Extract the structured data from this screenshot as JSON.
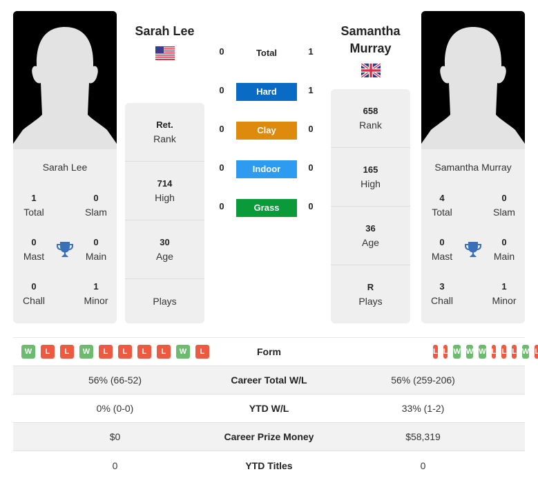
{
  "player1": {
    "name": "Sarah Lee",
    "country_flag": "us-flag-icon",
    "titles": {
      "total": {
        "value": "1",
        "label": "Total"
      },
      "slam": {
        "value": "0",
        "label": "Slam"
      },
      "mast": {
        "value": "0",
        "label": "Mast"
      },
      "main": {
        "value": "0",
        "label": "Main"
      },
      "chall": {
        "value": "0",
        "label": "Chall"
      },
      "minor": {
        "value": "1",
        "label": "Minor"
      }
    },
    "stats": {
      "rank": {
        "value": "Ret.",
        "label": "Rank"
      },
      "high": {
        "value": "714",
        "label": "High"
      },
      "age": {
        "value": "30",
        "label": "Age"
      },
      "plays": {
        "value": "",
        "label": "Plays"
      }
    },
    "form": [
      "W",
      "L",
      "L",
      "W",
      "L",
      "L",
      "L",
      "L",
      "W",
      "L"
    ]
  },
  "player2": {
    "name": "Samantha Murray",
    "country_flag": "uk-flag-icon",
    "titles": {
      "total": {
        "value": "4",
        "label": "Total"
      },
      "slam": {
        "value": "0",
        "label": "Slam"
      },
      "mast": {
        "value": "0",
        "label": "Mast"
      },
      "main": {
        "value": "0",
        "label": "Main"
      },
      "chall": {
        "value": "3",
        "label": "Chall"
      },
      "minor": {
        "value": "1",
        "label": "Minor"
      }
    },
    "stats": {
      "rank": {
        "value": "658",
        "label": "Rank"
      },
      "high": {
        "value": "165",
        "label": "High"
      },
      "age": {
        "value": "36",
        "label": "Age"
      },
      "plays": {
        "value": "R",
        "label": "Plays"
      }
    },
    "form": [
      "L",
      "L",
      "W",
      "W",
      "W",
      "L",
      "L",
      "L",
      "W",
      "L"
    ]
  },
  "h2h": {
    "total": {
      "label": "Total",
      "p1": "0",
      "p2": "1"
    },
    "surfaces": [
      {
        "label": "Hard",
        "p1": "0",
        "p2": "1",
        "color": "#0a6bc4"
      },
      {
        "label": "Clay",
        "p1": "0",
        "p2": "0",
        "color": "#de8a0c"
      },
      {
        "label": "Indoor",
        "p1": "0",
        "p2": "0",
        "color": "#2d9bf0"
      },
      {
        "label": "Grass",
        "p1": "0",
        "p2": "0",
        "color": "#0b9a3a"
      }
    ]
  },
  "comparison": {
    "form_label": "Form",
    "rows": [
      {
        "label": "Career Total W/L",
        "p1": "56% (66-52)",
        "p2": "56% (259-206)"
      },
      {
        "label": "YTD W/L",
        "p1": "0% (0-0)",
        "p2": "33% (1-2)"
      },
      {
        "label": "Career Prize Money",
        "p1": "$0",
        "p2": "$58,319"
      },
      {
        "label": "YTD Titles",
        "p1": "0",
        "p2": "0"
      }
    ]
  },
  "colors": {
    "win": "#6dbb6f",
    "loss": "#ee5a41",
    "trophy": "#3a6fba"
  }
}
